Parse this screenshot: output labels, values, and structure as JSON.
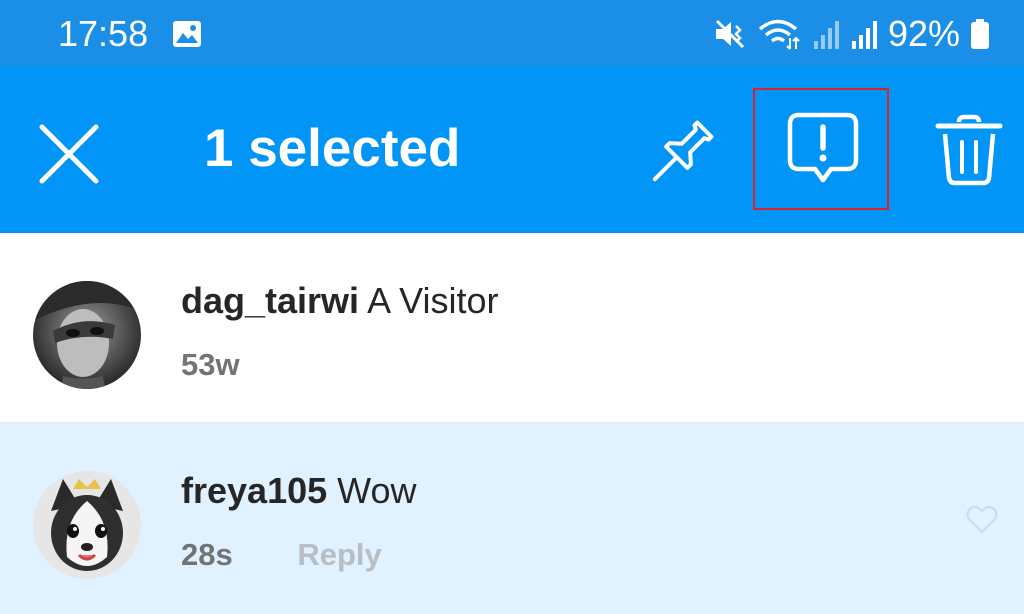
{
  "status_bar": {
    "time": "17:58",
    "battery": "92%",
    "icons": [
      "gallery-icon",
      "mute-vibrate-icon",
      "wifi-data-icon",
      "signal-icon",
      "signal-icon",
      "battery-icon"
    ]
  },
  "app_bar": {
    "title": "1 selected",
    "background": "#0095f6",
    "actions": [
      "close-icon",
      "pin-icon",
      "report-icon",
      "trash-icon"
    ],
    "highlight_color": "#e0202b"
  },
  "comments": [
    {
      "username": "dag_tairwi",
      "text": "A Visitor",
      "time": "53w",
      "selected": false
    },
    {
      "username": "freya105",
      "text": "Wow",
      "time": "28s",
      "reply_label": "Reply",
      "selected": true
    }
  ],
  "colors": {
    "status_bar": "#1b8fe8",
    "selected_row": "#e0f1ff",
    "meta_text": "#737373",
    "reply_text": "#b9bec4"
  }
}
